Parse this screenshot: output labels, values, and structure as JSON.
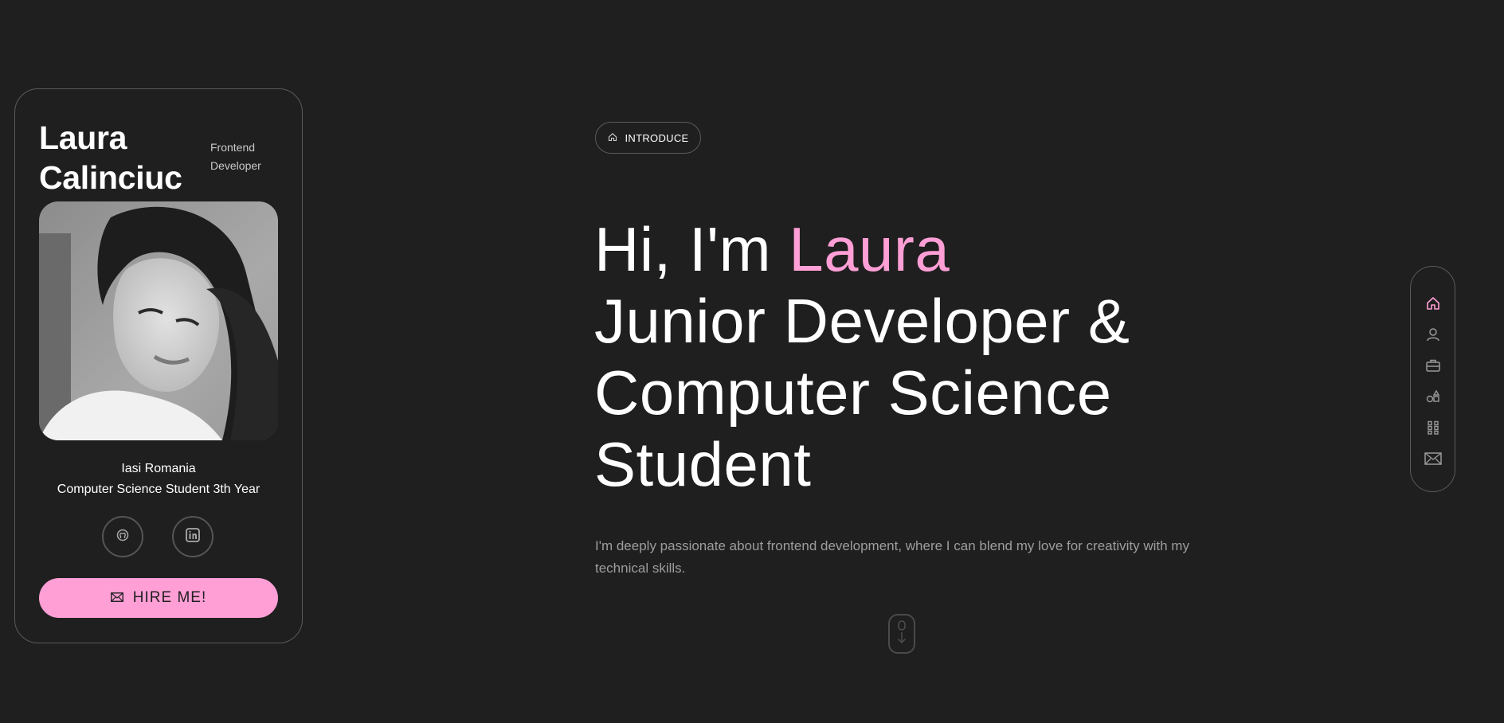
{
  "profile": {
    "first_name": "Laura",
    "last_name": "Calinciuc",
    "role_line1": "Frontend",
    "role_line2": "Developer",
    "location": "Iasi Romania",
    "study": "Computer Science Student 3th Year",
    "hire_label": "HIRE ME!"
  },
  "social": [
    {
      "icon": "github-icon"
    },
    {
      "icon": "linkedin-icon"
    }
  ],
  "intro": {
    "badge_label": "INTRODUCE",
    "greeting": "Hi, I'm ",
    "highlight_name": "Laura",
    "title_line1": "Junior Developer &",
    "title_line2": "Computer Science",
    "title_line3": "Student",
    "description": "I'm deeply passionate about frontend development, where I can blend my love for creativity with my technical skills."
  },
  "nav_icons": [
    "home-icon",
    "user-icon",
    "briefcase-icon",
    "shapes-icon",
    "grid-icon",
    "mail-icon"
  ],
  "colors": {
    "background": "#1f1f1f",
    "accent": "#ff9fd6",
    "border": "#5a5a5a",
    "muted_text": "#9d9d9d"
  }
}
